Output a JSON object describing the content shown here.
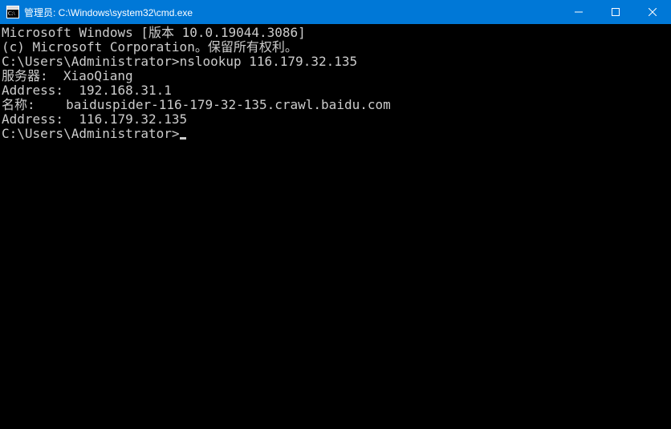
{
  "titlebar": {
    "title": "管理员: C:\\Windows\\system32\\cmd.exe"
  },
  "terminal": {
    "line1": "Microsoft Windows [版本 10.0.19044.3086]",
    "line2": "(c) Microsoft Corporation。保留所有权利。",
    "blank1": "",
    "line3a": "C:\\Users\\Administrator>",
    "line3b": "nslookup 116.179.32.135",
    "line4": "服务器:  XiaoQiang",
    "line5": "Address:  192.168.31.1",
    "blank2": "",
    "line6": "名称:    baiduspider-116-179-32-135.crawl.baidu.com",
    "line7": "Address:  116.179.32.135",
    "blank3": "",
    "blank4": "",
    "line8": "C:\\Users\\Administrator>"
  }
}
